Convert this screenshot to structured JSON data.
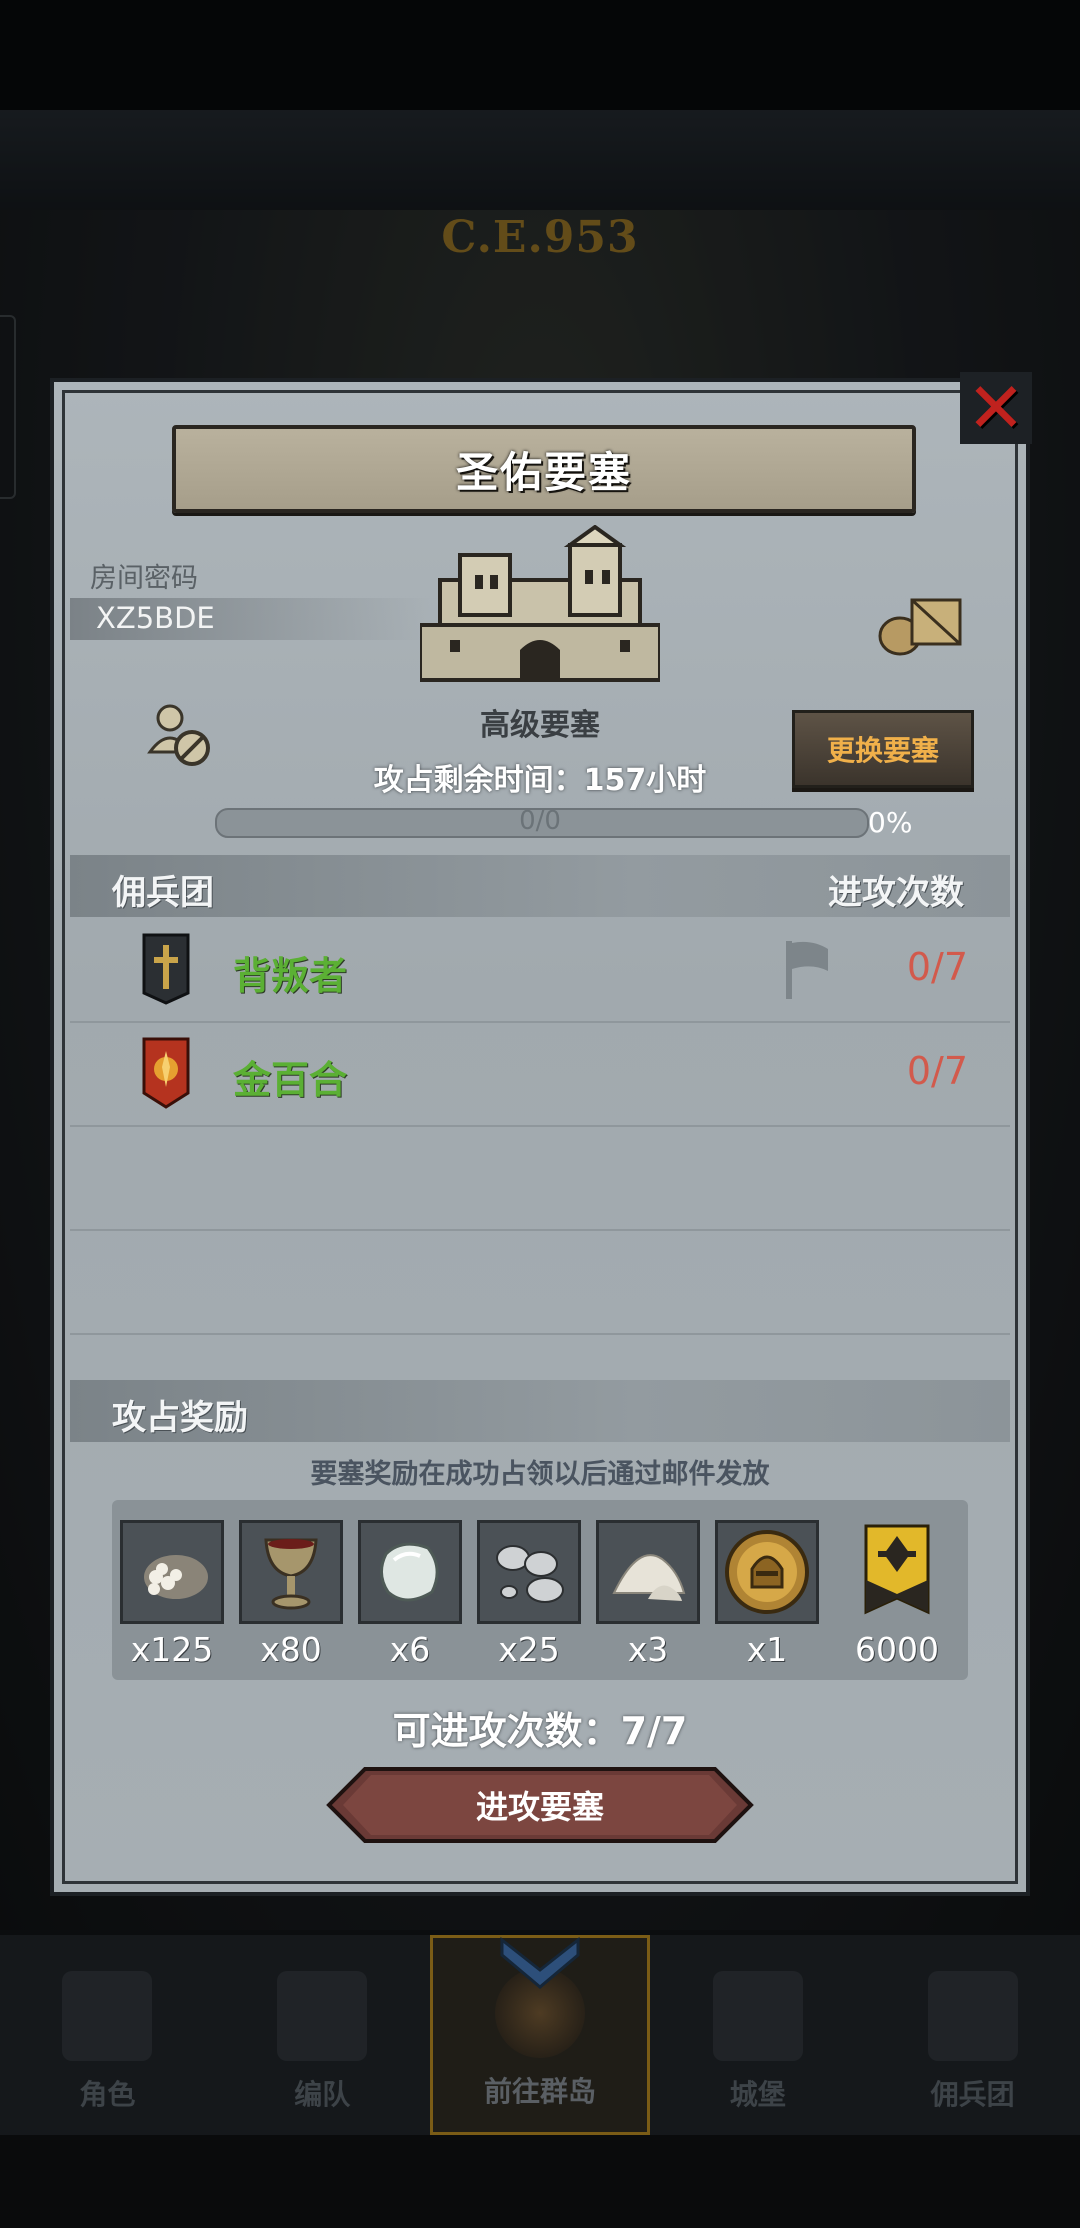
{
  "background": {
    "year": "C.E.953"
  },
  "panel": {
    "title": "圣佑要塞",
    "room_code_label": "房间密码",
    "room_code": "XZ5BDE",
    "fortress_grade": "高级要塞",
    "change_button": "更换要塞",
    "time_remaining": "攻占剩余时间：157小时",
    "progress_text": "0/0",
    "progress_percent": "0%",
    "progress_fraction": 0
  },
  "mercenaries": {
    "header": "佣兵团",
    "attack_count_header": "进攻次数",
    "rows": [
      {
        "name": "背叛者",
        "count": "0/7"
      },
      {
        "name": "金百合",
        "count": "0/7"
      }
    ]
  },
  "rewards": {
    "header": "攻占奖励",
    "note": "要塞奖励在成功占领以后通过邮件发放",
    "items": [
      {
        "icon": "stone-pile-icon",
        "qty": "x125"
      },
      {
        "icon": "goblet-icon",
        "qty": "x80"
      },
      {
        "icon": "gem-icon",
        "qty": "x6"
      },
      {
        "icon": "silver-ore-icon",
        "qty": "x25"
      },
      {
        "icon": "powder-pile-icon",
        "qty": "x3"
      },
      {
        "icon": "helmet-medal-icon",
        "qty": "x1"
      },
      {
        "icon": "honor-banner-icon",
        "qty": "6000"
      }
    ],
    "attacks_left": "可进攻次数：7/7",
    "attack_button": "进攻要塞"
  },
  "nav": {
    "items": [
      {
        "label": "角色"
      },
      {
        "label": "编队"
      },
      {
        "label": "前往群岛"
      },
      {
        "label": "城堡"
      },
      {
        "label": "佣兵团"
      }
    ],
    "active_index": 2
  },
  "colors": {
    "green_name": "#5bb034",
    "red_count": "#d25a4c",
    "gold_button_text": "#f0b04a",
    "close_red": "#c0221e"
  }
}
